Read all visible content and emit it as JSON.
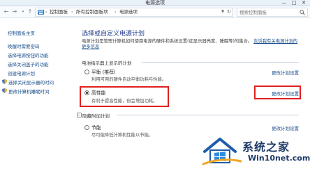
{
  "window": {
    "title": "电源选项",
    "controls": {
      "minimize": "—",
      "maximize": "□",
      "close": "✕"
    }
  },
  "address": {
    "breadcrumbs": [
      "控制面板",
      "所有控制面板项",
      "电源选项"
    ],
    "search_placeholder": "搜索控制面板"
  },
  "sidebar": {
    "items": [
      {
        "label": "控制面板主页"
      },
      {
        "label": "唤醒时需要密码"
      },
      {
        "label": "选择电源按钮的功能"
      },
      {
        "label": "选择关闭盖子的功能"
      },
      {
        "label": "创建电源计划"
      },
      {
        "label": "选择关闭显示器的时间"
      },
      {
        "label": "更改计算机睡眠时间"
      }
    ]
  },
  "main": {
    "heading": "选择或自定义电源计划",
    "description": "电源计划是管理计算机如何使用电源的硬件和系统设置(如显示器亮度、睡眠等)的集合。",
    "description_link": "告诉我有关电源计划的更多信息",
    "section_shown": "电池指示器上显示的计划",
    "section_hidden": "隐藏附加计划",
    "plans": [
      {
        "name": "平衡 (推荐)",
        "desc": "利用可用的硬件自动平衡功耗与性能。",
        "link": "更改计划设置",
        "checked": false
      },
      {
        "name": "高性能",
        "desc": "有利于提高性能，但会增加功耗。",
        "link": "更改计划设置",
        "checked": true
      },
      {
        "name": "节能",
        "desc": "尽可能降低计算机性能以节能。",
        "link": "更改计划设置",
        "checked": false
      }
    ]
  },
  "watermark": {
    "brand": "系统之家",
    "site": "Win10net.com"
  },
  "colors": {
    "link": "#1a4f8c",
    "heading": "#1e3a8a",
    "highlight": "#e02020"
  }
}
